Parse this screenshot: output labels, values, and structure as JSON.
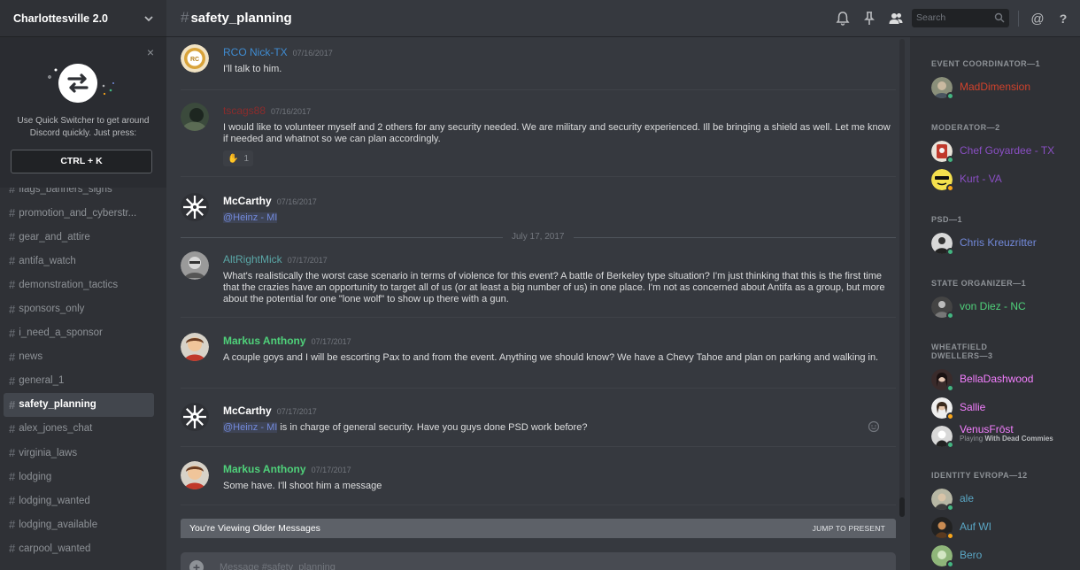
{
  "server": {
    "name": "Charlottesville 2.0"
  },
  "switcher": {
    "text": "Use Quick Switcher to get around Discord quickly. Just press:",
    "key": "CTRL + K",
    "close": "×"
  },
  "channels": [
    {
      "name": "flags_banners_signs",
      "active": false
    },
    {
      "name": "promotion_and_cyberstr...",
      "active": false
    },
    {
      "name": "gear_and_attire",
      "active": false
    },
    {
      "name": "antifa_watch",
      "active": false
    },
    {
      "name": "demonstration_tactics",
      "active": false
    },
    {
      "name": "sponsors_only",
      "active": false
    },
    {
      "name": "i_need_a_sponsor",
      "active": false
    },
    {
      "name": "news",
      "active": false
    },
    {
      "name": "general_1",
      "active": false
    },
    {
      "name": "safety_planning",
      "active": true
    },
    {
      "name": "alex_jones_chat",
      "active": false
    },
    {
      "name": "virginia_laws",
      "active": false
    },
    {
      "name": "lodging",
      "active": false
    },
    {
      "name": "lodging_wanted",
      "active": false
    },
    {
      "name": "lodging_available",
      "active": false
    },
    {
      "name": "carpool_wanted",
      "active": false
    }
  ],
  "header": {
    "hash": "#",
    "channel": "safety_planning",
    "search_placeholder": "Search",
    "icons": [
      "bell-icon",
      "pin-icon",
      "members-icon",
      "search-icon",
      "mention-icon",
      "help-icon"
    ],
    "at": "@",
    "help": "?"
  },
  "messages": [
    {
      "author": "RCO Nick-TX",
      "color": "#3f8bd0",
      "timestamp": "07/16/2017",
      "text": "I'll talk to him.",
      "avatar": "rco-logo"
    },
    {
      "author": "tscags88",
      "color": "#8b2c2c",
      "timestamp": "07/16/2017",
      "text": "I would like to volunteer myself and 2 others for any security needed. We are military and security experienced. Ill be bringing a shield as well. Let me know if needed and whatnot so we can plan accordingly.",
      "reaction_count": "1",
      "avatar": "photo"
    },
    {
      "author": "McCarthy",
      "color": "#ffffff",
      "timestamp": "07/16/2017",
      "mention": "@Heinz - MI",
      "text": "",
      "avatar": "snowflake"
    },
    {
      "author": "AltRightMick",
      "color": "#5aa6a6",
      "timestamp": "07/17/2017",
      "text": "What's realistically the worst case scenario in terms of violence for this event? A battle of Berkeley type situation? I'm just thinking that this is the first time that the crazies have an opportunity to target all of us (or at least a big number of us) in one place. I'm not as concerned about Antifa as a group, but more about the potential for one \"lone wolf\" to show up there with a gun.",
      "avatar": "photo-gray"
    },
    {
      "author": "Markus Anthony",
      "color": "#4fd17a",
      "timestamp": "07/17/2017",
      "text": "A couple goys and I will be escorting Pax to and from the event.  Anything we should know?  We have a Chevy Tahoe and plan on parking and walking in.",
      "avatar": "cartoon"
    },
    {
      "author": "McCarthy",
      "color": "#ffffff",
      "timestamp": "07/17/2017",
      "mention": "@Heinz - MI",
      "text": " is in charge of general security. Have you guys done PSD work before?",
      "avatar": "snowflake"
    },
    {
      "author": "Markus Anthony",
      "color": "#4fd17a",
      "timestamp": "07/17/2017",
      "text": "Some have.  I'll shoot him a message",
      "avatar": "cartoon"
    }
  ],
  "day_divider": "July 17, 2017",
  "older_bar": {
    "text": "You're Viewing Older Messages",
    "jump": "JUMP TO PRESENT"
  },
  "composer": {
    "placeholder": "Message #safety_planning"
  },
  "roles": [
    {
      "title": "EVENT COORDINATOR—1",
      "members": [
        {
          "name": "MadDimension",
          "color": "#d0422c",
          "status": "#43b581"
        }
      ]
    },
    {
      "title": "MODERATOR—2",
      "members": [
        {
          "name": "Chef Goyardee - TX",
          "color": "#8a4fc4",
          "status": "#43b581"
        },
        {
          "name": "Kurt - VA",
          "color": "#8a4fc4",
          "status": "#faa61a"
        }
      ]
    },
    {
      "title": "PSD—1",
      "members": [
        {
          "name": "Chris Kreuzritter",
          "color": "#7289da",
          "status": "#43b581"
        }
      ]
    },
    {
      "title": "STATE ORGANIZER—1",
      "members": [
        {
          "name": "von Diez - NC",
          "color": "#4fd17a",
          "status": "#43b581"
        }
      ]
    },
    {
      "title_line1": "WHEATFIELD",
      "title": "DWELLERS—3",
      "members": [
        {
          "name": "BellaDashwood",
          "color": "#f47fff",
          "status": "#43b581"
        },
        {
          "name": "Sallie",
          "color": "#f47fff",
          "status": "#faa61a"
        },
        {
          "name": "VenusFrōst",
          "color": "#f47fff",
          "status": "#43b581",
          "playing_prefix": "Playing ",
          "playing": "With Dead Commies"
        }
      ]
    },
    {
      "title": "IDENTITY EVROPA—12",
      "members": [
        {
          "name": "ale",
          "color": "#5aa6c4",
          "status": "#43b581"
        },
        {
          "name": "Auf WI",
          "color": "#5aa6c4",
          "status": "#faa61a"
        },
        {
          "name": "Bero",
          "color": "#5aa6c4",
          "status": "#43b581"
        }
      ]
    }
  ]
}
